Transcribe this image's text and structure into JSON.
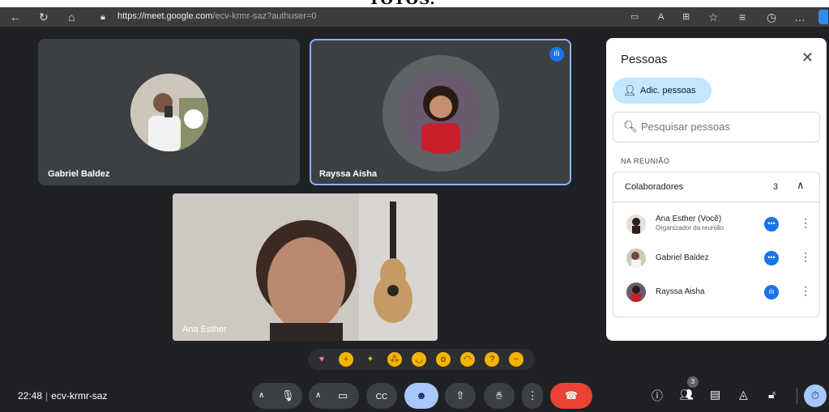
{
  "caption": "TOTOS.",
  "browser": {
    "url_host": "https://meet.google.com",
    "url_path": "/ecv-krmr-saz?authuser=0"
  },
  "tiles": [
    {
      "name": "Gabriel Baldez"
    },
    {
      "name": "Rayssa Aisha"
    },
    {
      "name": "Ana Esther"
    }
  ],
  "panel": {
    "title": "Pessoas",
    "add_label": "Adic. pessoas",
    "search_placeholder": "Pesquisar pessoas",
    "section_label": "NA REUNIÃO",
    "group": {
      "label": "Colaboradores",
      "count": "3"
    },
    "people": [
      {
        "name": "Ana Esther (Você)",
        "role": "Organizador da reunião"
      },
      {
        "name": "Gabriel Baldez",
        "role": ""
      },
      {
        "name": "Rayssa Aisha",
        "role": ""
      }
    ]
  },
  "bottom": {
    "time": "22:48",
    "meeting_code": "ecv-krmr-saz",
    "people_count": "3"
  },
  "colors": {
    "accent": "#1a73e8",
    "end_call": "#ea4335",
    "active_ctrl": "#a8c7fa"
  }
}
